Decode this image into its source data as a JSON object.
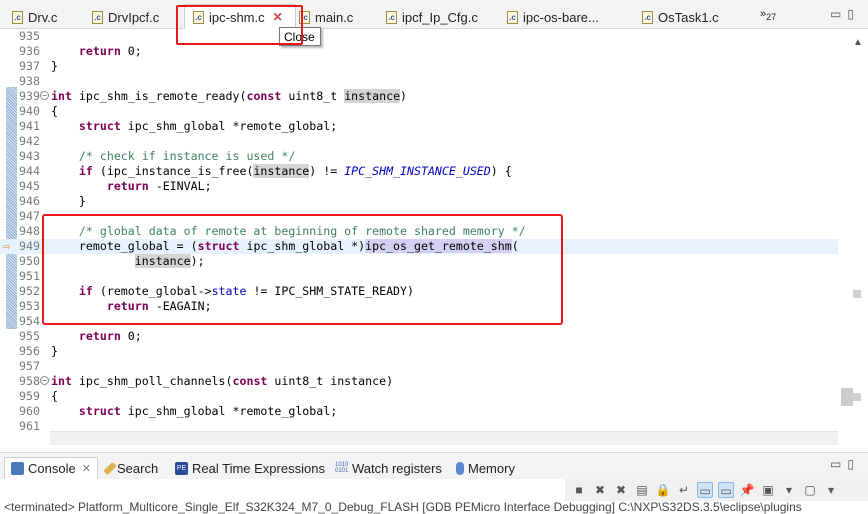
{
  "tabs": [
    {
      "label": "Drv.c"
    },
    {
      "label": "DrvIpcf.c"
    },
    {
      "label": "ipc-shm.c",
      "active": true
    },
    {
      "label": "main.c"
    },
    {
      "label": "ipcf_Ip_Cfg.c"
    },
    {
      "label": "ipc-os-bare..."
    },
    {
      "label": "OsTask1.c"
    }
  ],
  "tabs_overflow": {
    "symbol": "»",
    "count": "27"
  },
  "tooltip": "Close",
  "lines": [
    {
      "n": "935",
      "t": []
    },
    {
      "n": "936",
      "t": [
        [
          "    ",
          ""
        ],
        [
          "return",
          "k"
        ],
        [
          " 0;",
          ""
        ]
      ]
    },
    {
      "n": "937",
      "t": [
        [
          "}",
          ""
        ]
      ]
    },
    {
      "n": "938",
      "t": []
    },
    {
      "n": "939",
      "fold": true,
      "t": [
        [
          "int",
          "k"
        ],
        [
          " ipc_shm_is_remote_ready(",
          ""
        ],
        [
          "const",
          "k"
        ],
        [
          " uint8_t ",
          ""
        ],
        [
          "instance",
          "hl"
        ],
        [
          ")",
          ""
        ]
      ]
    },
    {
      "n": "940",
      "t": [
        [
          "{",
          ""
        ]
      ]
    },
    {
      "n": "941",
      "t": [
        [
          "    ",
          ""
        ],
        [
          "struct",
          "k"
        ],
        [
          " ipc_shm_global *remote_global;",
          ""
        ]
      ]
    },
    {
      "n": "942",
      "t": []
    },
    {
      "n": "943",
      "t": [
        [
          "    ",
          ""
        ],
        [
          "/* check if instance is used */",
          "cm"
        ]
      ]
    },
    {
      "n": "944",
      "t": [
        [
          "    ",
          ""
        ],
        [
          "if",
          "k"
        ],
        [
          " (ipc_instance_is_free(",
          ""
        ],
        [
          "instance",
          "hl"
        ],
        [
          ") != ",
          ""
        ],
        [
          "IPC_SHM_INSTANCE_USED",
          "mac"
        ],
        [
          ") {",
          ""
        ]
      ]
    },
    {
      "n": "945",
      "t": [
        [
          "        ",
          ""
        ],
        [
          "return",
          "k"
        ],
        [
          " -EINVAL;",
          ""
        ]
      ]
    },
    {
      "n": "946",
      "t": [
        [
          "    }",
          ""
        ]
      ]
    },
    {
      "n": "947",
      "t": []
    },
    {
      "n": "948",
      "t": [
        [
          "    ",
          ""
        ],
        [
          "/* global data of remote at beginning of remote shared memory */",
          "cm"
        ]
      ]
    },
    {
      "n": "949",
      "cur": true,
      "arrow": true,
      "t": [
        [
          "    remote_global = (",
          ""
        ],
        [
          "struct",
          "k"
        ],
        [
          " ipc_shm_global *)",
          ""
        ],
        [
          "ipc_os_get_remote_shm",
          "hl2"
        ],
        [
          "(",
          ""
        ]
      ]
    },
    {
      "n": "950",
      "t": [
        [
          "            ",
          ""
        ],
        [
          "instance",
          "hl"
        ],
        [
          ");",
          ""
        ]
      ]
    },
    {
      "n": "951",
      "t": []
    },
    {
      "n": "952",
      "t": [
        [
          "    ",
          ""
        ],
        [
          "if",
          "k"
        ],
        [
          " (remote_global->",
          ""
        ],
        [
          "state",
          "fld"
        ],
        [
          " != IPC_SHM_STATE_READY)",
          ""
        ]
      ]
    },
    {
      "n": "953",
      "t": [
        [
          "        ",
          ""
        ],
        [
          "return",
          "k"
        ],
        [
          " -EAGAIN;",
          ""
        ]
      ]
    },
    {
      "n": "954",
      "t": []
    },
    {
      "n": "955",
      "t": [
        [
          "    ",
          ""
        ],
        [
          "return",
          "k"
        ],
        [
          " 0;",
          ""
        ]
      ]
    },
    {
      "n": "956",
      "t": [
        [
          "}",
          ""
        ]
      ]
    },
    {
      "n": "957",
      "t": []
    },
    {
      "n": "958",
      "fold": true,
      "t": [
        [
          "int",
          "k"
        ],
        [
          " ipc_shm_poll_channels(",
          ""
        ],
        [
          "const",
          "k"
        ],
        [
          " uint8_t instance)",
          ""
        ]
      ]
    },
    {
      "n": "959",
      "t": [
        [
          "{",
          ""
        ]
      ]
    },
    {
      "n": "960",
      "t": [
        [
          "    ",
          ""
        ],
        [
          "struct",
          "k"
        ],
        [
          " ipc_shm_global *remote_global;",
          ""
        ]
      ]
    },
    {
      "n": "961",
      "t": []
    }
  ],
  "panel": {
    "tabs": [
      {
        "label": "Console",
        "icon": "console-icon"
      },
      {
        "label": "Search",
        "icon": "search-icon"
      },
      {
        "label": "Real Time Expressions",
        "icon": "pe-icon"
      },
      {
        "label": "Watch registers",
        "icon": "registers-icon"
      },
      {
        "label": "Memory",
        "icon": "memory-icon"
      }
    ],
    "console_text": "<terminated> Platform_Multicore_Single_Elf_S32K324_M7_0_Debug_FLASH [GDB PEMicro Interface Debugging] C:\\NXP\\S32DS.3.5\\eclipse\\plugins"
  },
  "colors": {
    "keyword": "#7f0055",
    "comment": "#3f7f5f",
    "macro": "#0000c0",
    "highlight_box": "#e81818"
  }
}
